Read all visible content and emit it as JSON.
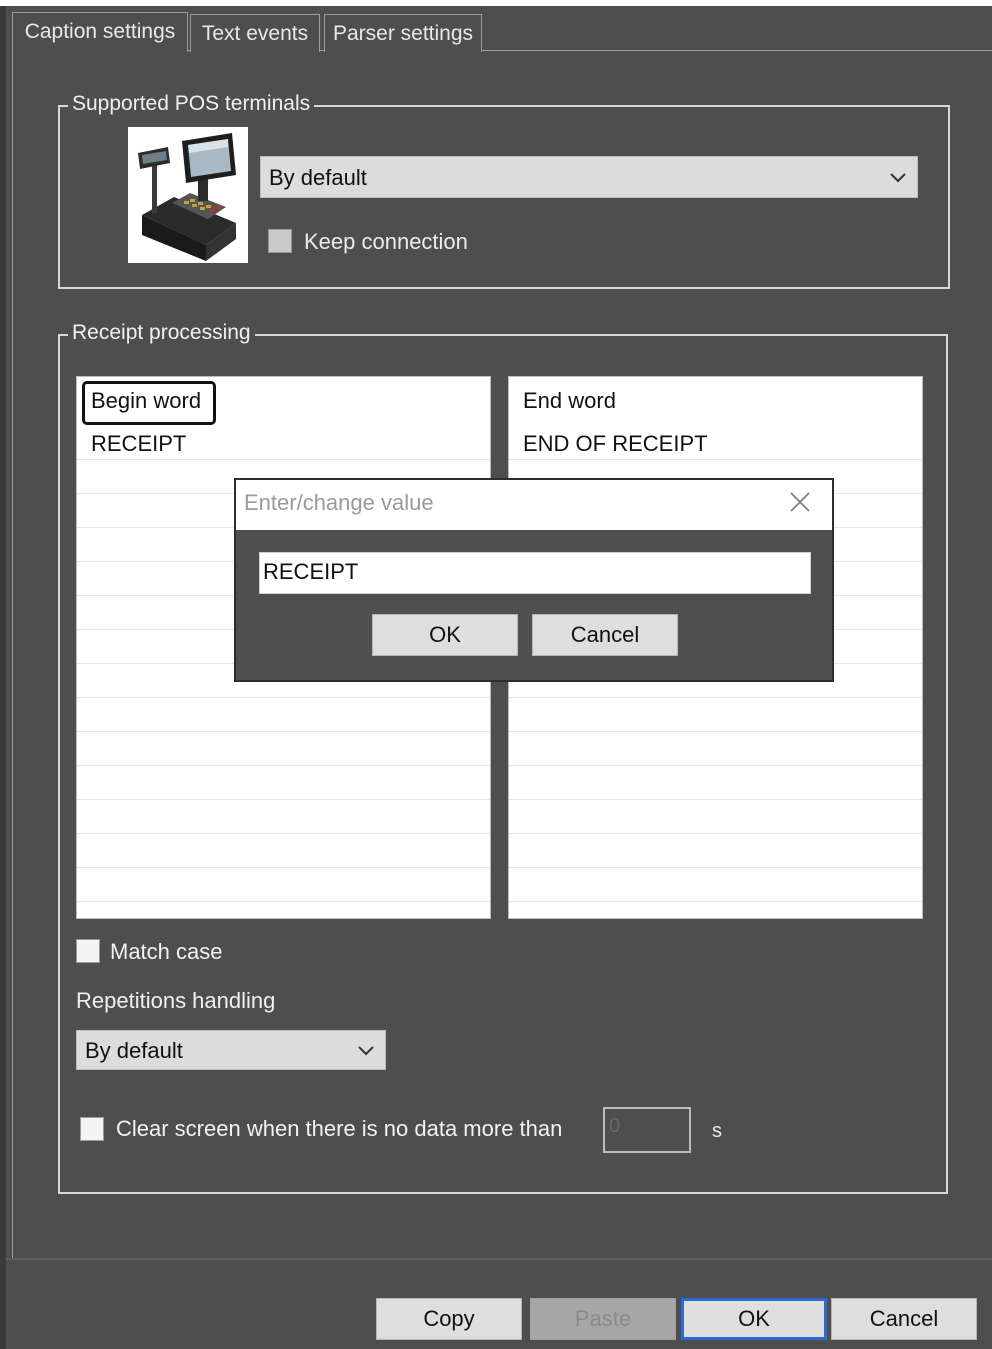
{
  "tabs": [
    {
      "label": "Caption settings",
      "active": true
    },
    {
      "label": "Text events",
      "active": false
    },
    {
      "label": "Parser settings",
      "active": false
    }
  ],
  "pos_group": {
    "title": "Supported POS terminals",
    "image_icon": "pos-terminal-image",
    "combo_value": "By default",
    "keep_connection_label": "Keep connection",
    "keep_connection_checked": false
  },
  "receipt_group": {
    "title": "Receipt processing",
    "begin_list": {
      "header": "Begin word",
      "items": [
        "RECEIPT"
      ]
    },
    "end_list": {
      "header": "End word",
      "items": [
        "END OF RECEIPT"
      ]
    },
    "match_case_label": "Match case",
    "match_case_checked": false,
    "repetitions_label": "Repetitions handling",
    "repetitions_value": "By default",
    "clear_screen_label": "Clear screen when there is no data more than",
    "clear_screen_checked": false,
    "seconds_value": "0",
    "seconds_unit": "s"
  },
  "dialog": {
    "title": "Enter/change value",
    "input_value": "RECEIPT",
    "ok_label": "OK",
    "cancel_label": "Cancel"
  },
  "footer": {
    "copy_label": "Copy",
    "paste_label": "Paste",
    "ok_label": "OK",
    "cancel_label": "Cancel"
  },
  "colors": {
    "window_bg": "#4e4e4e",
    "focus_border": "#2a6bd6",
    "highlight_border": "#111111"
  }
}
